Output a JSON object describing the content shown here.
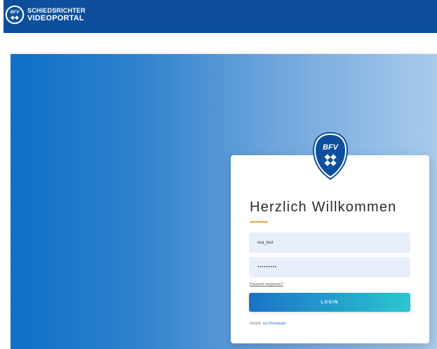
{
  "header": {
    "brand_line1": "SCHIEDSRICHTER",
    "brand_line2": "VIDEOPORTAL",
    "logo_text": "BFV",
    "background_color": "#0d4f9c"
  },
  "login": {
    "logo_text": "BFV",
    "welcome": "Herzlich Willkommen",
    "username_value": "vsa_test",
    "password_value": "•••••••••",
    "forgot_password": "Passwort vergessen?",
    "login_button": "LOGIN",
    "back_text": "Zurück",
    "back_link": "zur Homepage",
    "accent_color": "#f0a24a",
    "button_gradient": [
      "#1a73c7",
      "#2cc6d0"
    ]
  },
  "icons": {
    "header_logo": "bfv-logo-icon",
    "card_logo": "bfv-shield-icon"
  }
}
